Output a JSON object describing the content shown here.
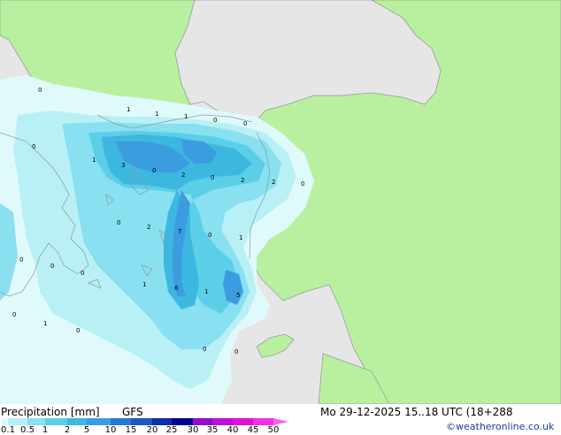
{
  "legend": {
    "title": "Precipitation [mm]",
    "model": "GFS",
    "datetime": "Mo 29-12-2025 15..18 UTC (18+288",
    "credit": "©weatheronline.co.uk",
    "ticks": [
      "0.1",
      "0.5",
      "1",
      "2",
      "5",
      "10",
      "15",
      "20",
      "25",
      "30",
      "35",
      "40",
      "45",
      "50"
    ],
    "colors": [
      "#e0fafc",
      "#b8f0f6",
      "#88e0f0",
      "#5ccfe8",
      "#3cb8e0",
      "#3c9ce0",
      "#2a78d0",
      "#1c58c0",
      "#0c30a8",
      "#000090",
      "#9010c8",
      "#c010d8",
      "#e010d8",
      "#f030e8",
      "#ff60f0"
    ]
  },
  "map_labels": [
    {
      "id": "l1",
      "text": "0"
    },
    {
      "id": "l2",
      "text": "1"
    },
    {
      "id": "l3",
      "text": "1"
    },
    {
      "id": "l4",
      "text": "1"
    },
    {
      "id": "l5",
      "text": "0"
    },
    {
      "id": "l6",
      "text": "0"
    },
    {
      "id": "l7",
      "text": "0"
    },
    {
      "id": "l8",
      "text": "1"
    },
    {
      "id": "l9",
      "text": "3"
    },
    {
      "id": "l10",
      "text": "0"
    },
    {
      "id": "l11",
      "text": "2"
    },
    {
      "id": "l12",
      "text": "0"
    },
    {
      "id": "l13",
      "text": "2"
    },
    {
      "id": "l14",
      "text": "2"
    },
    {
      "id": "l15",
      "text": "0"
    },
    {
      "id": "l16",
      "text": "0"
    },
    {
      "id": "l17",
      "text": "2"
    },
    {
      "id": "l18",
      "text": "7"
    },
    {
      "id": "l19",
      "text": "0"
    },
    {
      "id": "l20",
      "text": "1"
    },
    {
      "id": "l21",
      "text": "0"
    },
    {
      "id": "l22",
      "text": "0"
    },
    {
      "id": "l23",
      "text": "0"
    },
    {
      "id": "l24",
      "text": "1"
    },
    {
      "id": "l25",
      "text": "6"
    },
    {
      "id": "l26",
      "text": "1"
    },
    {
      "id": "l27",
      "text": "5"
    },
    {
      "id": "l28",
      "text": "0"
    },
    {
      "id": "l29",
      "text": "1"
    },
    {
      "id": "l30",
      "text": "0"
    },
    {
      "id": "l31",
      "text": "0"
    },
    {
      "id": "l32",
      "text": "0"
    }
  ]
}
